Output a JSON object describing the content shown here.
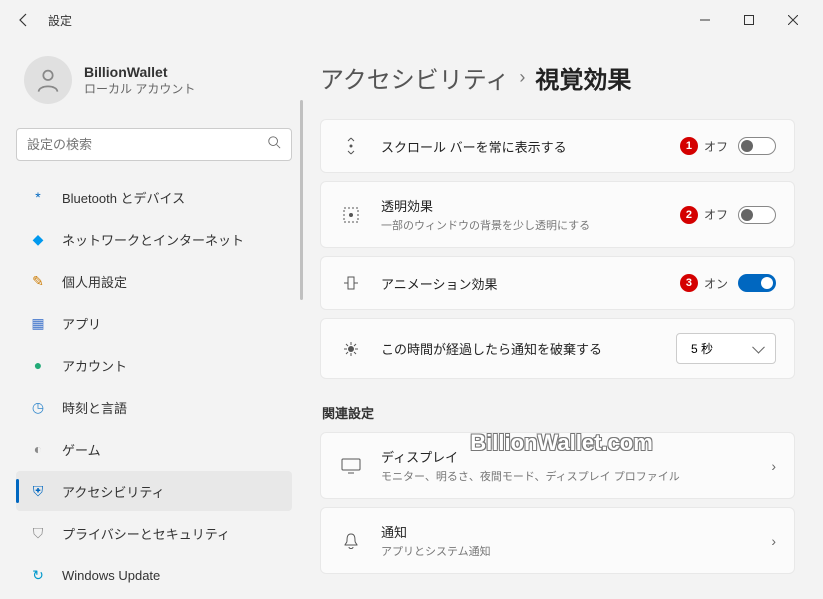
{
  "window": {
    "title": "設定"
  },
  "profile": {
    "name": "BillionWallet",
    "account_type": "ローカル アカウント"
  },
  "search": {
    "placeholder": "設定の検索"
  },
  "sidebar": {
    "items": [
      {
        "label": "Bluetooth とデバイス",
        "icon": "*",
        "color": "#0067c0"
      },
      {
        "label": "ネットワークとインターネット",
        "icon": "◆",
        "color": "#0099ee"
      },
      {
        "label": "個人用設定",
        "icon": "✎",
        "color": "#cc7a00"
      },
      {
        "label": "アプリ",
        "icon": "▦",
        "color": "#4477cc"
      },
      {
        "label": "アカウント",
        "icon": "●",
        "color": "#22aa77"
      },
      {
        "label": "時刻と言語",
        "icon": "◷",
        "color": "#3388cc"
      },
      {
        "label": "ゲーム",
        "icon": "◐",
        "color": "#888"
      },
      {
        "label": "アクセシビリティ",
        "icon": "⛨",
        "color": "#0067c0"
      },
      {
        "label": "プライバシーとセキュリティ",
        "icon": "⛉",
        "color": "#888"
      },
      {
        "label": "Windows Update",
        "icon": "↻",
        "color": "#0099cc"
      }
    ]
  },
  "breadcrumb": {
    "parent": "アクセシビリティ",
    "current": "視覚効果"
  },
  "settings": [
    {
      "title": "スクロール バーを常に表示する",
      "sub": "",
      "badge": "1",
      "state_label": "オフ",
      "toggle": "off"
    },
    {
      "title": "透明効果",
      "sub": "一部のウィンドウの背景を少し透明にする",
      "badge": "2",
      "state_label": "オフ",
      "toggle": "off"
    },
    {
      "title": "アニメーション効果",
      "sub": "",
      "badge": "3",
      "state_label": "オン",
      "toggle": "on"
    },
    {
      "title": "この時間が経過したら通知を破棄する",
      "dropdown_value": "5 秒"
    }
  ],
  "related": {
    "heading": "関連設定",
    "items": [
      {
        "title": "ディスプレイ",
        "sub": "モニター、明るさ、夜間モード、ディスプレイ プロファイル"
      },
      {
        "title": "通知",
        "sub": "アプリとシステム通知"
      }
    ]
  },
  "watermark": "BillionWallet.com"
}
